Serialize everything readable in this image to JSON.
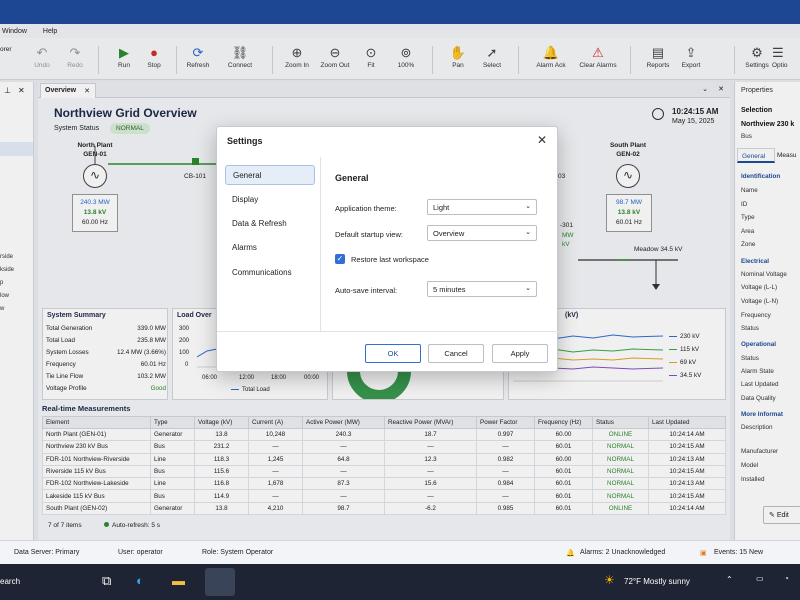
{
  "menu": {
    "items": [
      "Window",
      "Help"
    ],
    "left_fragment": "orer"
  },
  "toolbar": {
    "undo": "Undo",
    "redo": "Redo",
    "run": "Run",
    "stop": "Stop",
    "refresh": "Refresh",
    "connect": "Connect",
    "zoom_in": "Zoom In",
    "zoom_out": "Zoom Out",
    "fit": "Fit",
    "zoom_level": "100%",
    "pan": "Pan",
    "select": "Select",
    "alarm_ack": "Alarm Ack",
    "clear_alarms": "Clear Alarms",
    "reports": "Reports",
    "export": "Export",
    "settings": "Settings",
    "options": "Optio"
  },
  "left_pane": {
    "items": [
      "rside",
      "kside",
      "p",
      "low",
      "w"
    ]
  },
  "tab": {
    "label": "Overview"
  },
  "overview": {
    "title": "Northview Grid Overview",
    "status_label": "System Status",
    "status_value": "NORMAL",
    "time": "10:24:15 AM",
    "date": "May 15, 2025"
  },
  "diagram": {
    "north_plant": {
      "name": "North Plant",
      "id": "GEN-01",
      "mw": "240.3 MW",
      "kv": "13.8 kV",
      "hz": "60.00 Hz"
    },
    "south_plant": {
      "name": "South Plant",
      "id": "GEN-02",
      "mw": "98.7 MW",
      "kv": "13.8 kV",
      "hz": "60.01 Hz"
    },
    "cb101": "CB-101",
    "meadow": "Meadow 34.5 kV",
    "frag_03": "03",
    "frag_301": "-301",
    "frag_mw": "MW",
    "frag_kv": "kV"
  },
  "summary": {
    "title": "System Summary",
    "rows": [
      {
        "label": "Total Generation",
        "value": "339.0 MW"
      },
      {
        "label": "Total Load",
        "value": "235.8 MW"
      },
      {
        "label": "System Losses",
        "value": "12.4 MW (3.66%)"
      },
      {
        "label": "Frequency",
        "value": "60.01 Hz"
      },
      {
        "label": "Tie Line Flow",
        "value": "103.2 MW"
      },
      {
        "label": "Voltage Profile",
        "value": "Good"
      }
    ]
  },
  "load_panel": {
    "title": "Load Over",
    "y_ticks": [
      "300",
      "200",
      "100",
      "0"
    ],
    "x_ticks": [
      "06:00",
      "12:00",
      "18:00",
      "00:00"
    ],
    "legend": "Total Load"
  },
  "voltage_panel": {
    "title": "(kV)",
    "legend": [
      "230 kV",
      "115 kV",
      "69 kV",
      "34.5 kV"
    ],
    "legend_colors": [
      "#2f6fd6",
      "#3aa84a",
      "#e3a52a",
      "#8a4fc4"
    ]
  },
  "measurements": {
    "title": "Real-time Measurements",
    "columns": [
      "Element",
      "Type",
      "Voltage (kV)",
      "Current (A)",
      "Active Power (MW)",
      "Reactive Power (MVAr)",
      "Power Factor",
      "Frequency (Hz)",
      "Status",
      "Last Updated"
    ],
    "rows": [
      [
        "North Plant (GEN-01)",
        "Generator",
        "13.8",
        "10,248",
        "240.3",
        "18.7",
        "0.997",
        "60.00",
        "ONLINE",
        "10:24:14 AM"
      ],
      [
        "Northview 230 kV Bus",
        "Bus",
        "231.2",
        "—",
        "—",
        "—",
        "—",
        "60.01",
        "NORMAL",
        "10:24:15 AM"
      ],
      [
        "FDR-101 Northview-Riverside",
        "Line",
        "118.3",
        "1,245",
        "64.8",
        "12.3",
        "0.982",
        "60.00",
        "NORMAL",
        "10:24:13 AM"
      ],
      [
        "Riverside 115 kV Bus",
        "Bus",
        "115.6",
        "—",
        "—",
        "—",
        "—",
        "60.01",
        "NORMAL",
        "10:24:15 AM"
      ],
      [
        "FDR-102 Northview-Lakeside",
        "Line",
        "116.8",
        "1,678",
        "87.3",
        "15.6",
        "0.984",
        "60.01",
        "NORMAL",
        "10:24:13 AM"
      ],
      [
        "Lakeside 115 kV Bus",
        "Bus",
        "114.9",
        "—",
        "—",
        "—",
        "—",
        "60.01",
        "NORMAL",
        "10:24:15 AM"
      ],
      [
        "South Plant (GEN-02)",
        "Generator",
        "13.8",
        "4,210",
        "98.7",
        "-6.2",
        "0.985",
        "60.01",
        "ONLINE",
        "10:24:14 AM"
      ]
    ],
    "footer_count": "7 of 7 items",
    "auto_refresh": "Auto-refresh: 5 s"
  },
  "properties": {
    "title": "Properties",
    "selection_label": "Selection",
    "selection_name": "Northview 230 k",
    "selection_type": "Bus",
    "tabs": [
      "General",
      "Measu"
    ],
    "identification": "Identification",
    "id_fields": [
      "Name",
      "ID",
      "Type",
      "Area",
      "Zone"
    ],
    "electrical": "Electrical",
    "el_fields": [
      "Nominal Voltage",
      "Voltage (L-L)",
      "Voltage (L-N)",
      "Frequency",
      "Status"
    ],
    "operational": "Operational",
    "op_fields": [
      "Status",
      "Alarm State",
      "Last Updated",
      "Data Quality"
    ],
    "more_info": "More Informat",
    "mi_fields": [
      "Description",
      "Manufacturer",
      "Model",
      "Installed"
    ],
    "edit": "Edit"
  },
  "statusbar": {
    "data_server": "Data Server: Primary",
    "user": "User: operator",
    "role": "Role: System Operator",
    "alarms": "Alarms: 2 Unacknowledged",
    "events": "Events: 15 New"
  },
  "taskbar": {
    "search": "earch",
    "weather": "72°F  Mostly sunny"
  },
  "dialog": {
    "title": "Settings",
    "nav": [
      "General",
      "Display",
      "Data & Refresh",
      "Alarms",
      "Communications"
    ],
    "section": "General",
    "theme_label": "Application theme:",
    "theme_value": "Light",
    "startup_label": "Default startup view:",
    "startup_value": "Overview",
    "restore_label": "Restore last workspace",
    "restore_checked": true,
    "autosave_label": "Auto-save interval:",
    "autosave_value": "5 minutes",
    "ok": "OK",
    "cancel": "Cancel",
    "apply": "Apply"
  }
}
